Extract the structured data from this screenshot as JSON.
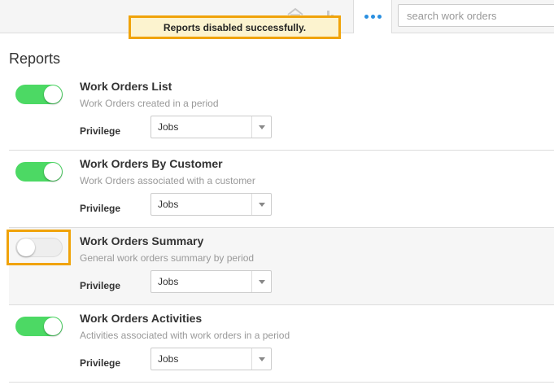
{
  "topbar": {
    "home_icon": "home-icon",
    "chart_icon": "bar-chart-icon",
    "more_icon": "more-dots-icon",
    "search": {
      "placeholder": "search work orders",
      "value": ""
    },
    "accent_color": "#2a8fe0"
  },
  "notice": {
    "text": "Reports disabled successfully.",
    "border_color": "#f0a30a",
    "background": "#fcf3cf"
  },
  "page": {
    "title": "Reports"
  },
  "reports": [
    {
      "title": "Work Orders List",
      "description": "Work Orders created in a period",
      "enabled": true,
      "privilege_label": "Privilege",
      "privilege_value": "Jobs"
    },
    {
      "title": "Work Orders By Customer",
      "description": "Work Orders associated with a customer",
      "enabled": true,
      "privilege_label": "Privilege",
      "privilege_value": "Jobs"
    },
    {
      "title": "Work Orders Summary",
      "description": "General work orders summary by period",
      "enabled": false,
      "privilege_label": "Privilege",
      "privilege_value": "Jobs"
    },
    {
      "title": "Work Orders Activities",
      "description": "Activities associated with work orders in a period",
      "enabled": true,
      "privilege_label": "Privilege",
      "privilege_value": "Jobs"
    }
  ],
  "colors": {
    "toggle_on": "#4cd964",
    "toggle_off": "#eeeeee"
  }
}
